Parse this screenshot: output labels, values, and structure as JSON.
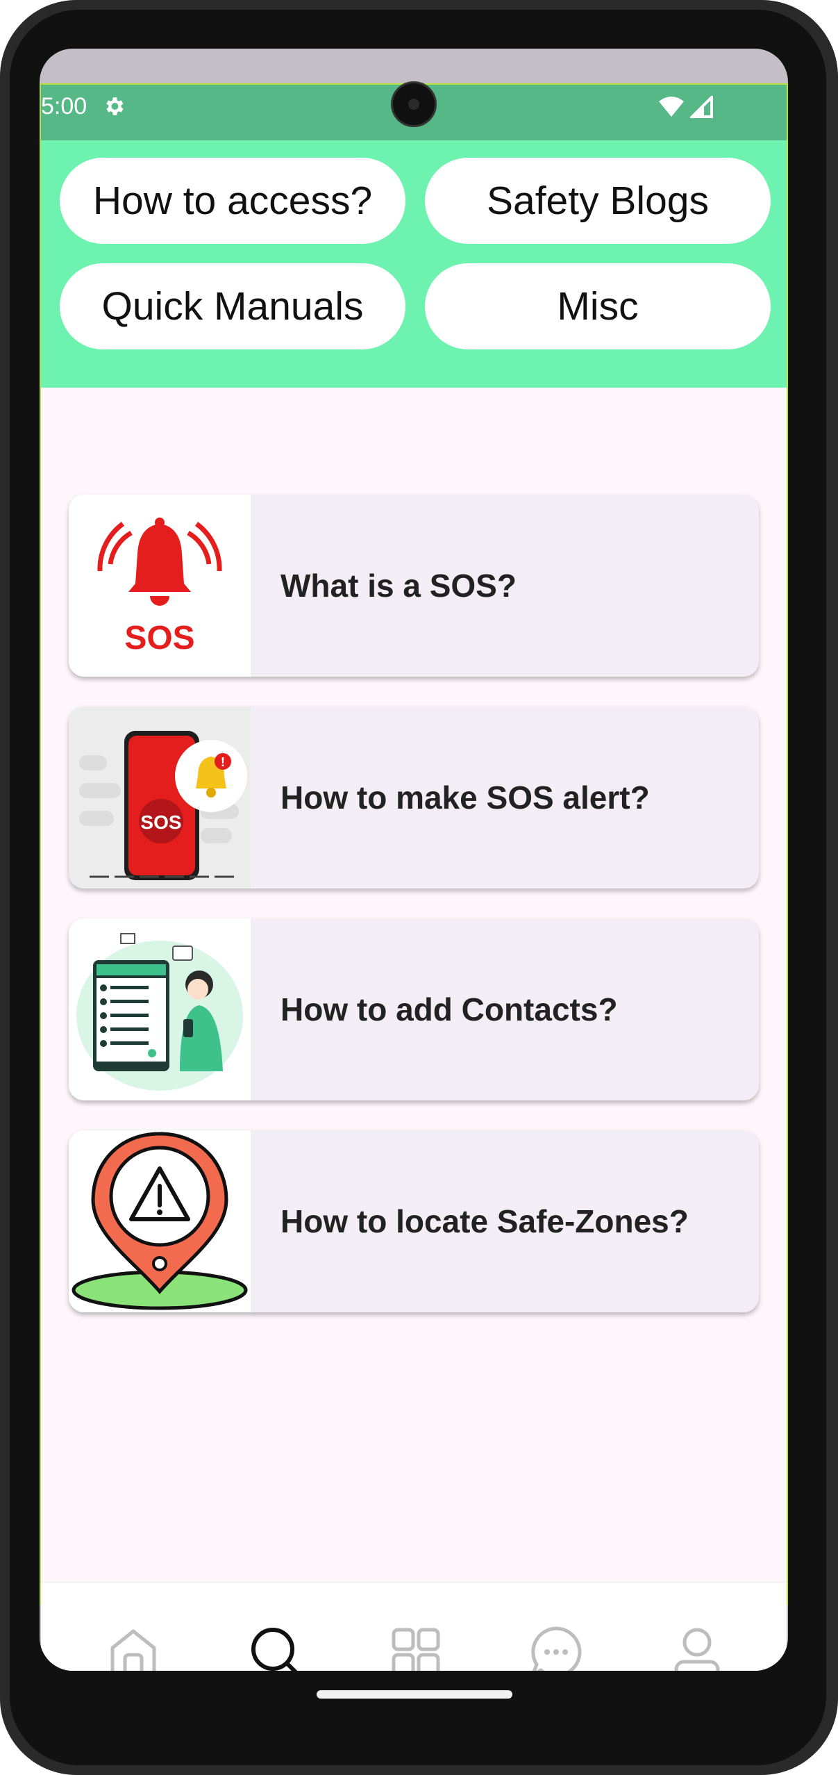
{
  "status_bar": {
    "time": "5:00",
    "icons": [
      "gear-icon",
      "wifi-icon",
      "signal-icon"
    ]
  },
  "top_tabs": [
    {
      "label": "How to access?"
    },
    {
      "label": "Safety Blogs"
    },
    {
      "label": "Quick Manuals"
    },
    {
      "label": "Misc"
    }
  ],
  "cards": [
    {
      "title": "What is a SOS?",
      "thumb_icon": "sos-bell-icon",
      "thumb_text": "SOS"
    },
    {
      "title": "How to make SOS alert?",
      "thumb_icon": "phone-sos-alert-icon",
      "thumb_text": "SOS"
    },
    {
      "title": "How to add Contacts?",
      "thumb_icon": "contacts-illustration-icon"
    },
    {
      "title": "How to locate Safe-Zones?",
      "thumb_icon": "location-warning-icon"
    }
  ],
  "bottom_nav": {
    "items": [
      "home-icon",
      "search-icon",
      "grid-icon",
      "chat-icon",
      "profile-icon"
    ],
    "active": "search-icon"
  },
  "colors": {
    "status_bar": "#57b887",
    "top_bar": "#6ef2af",
    "background": "#fdf6fb",
    "card": "#f3eef5",
    "sos_red": "#e41d1d"
  }
}
